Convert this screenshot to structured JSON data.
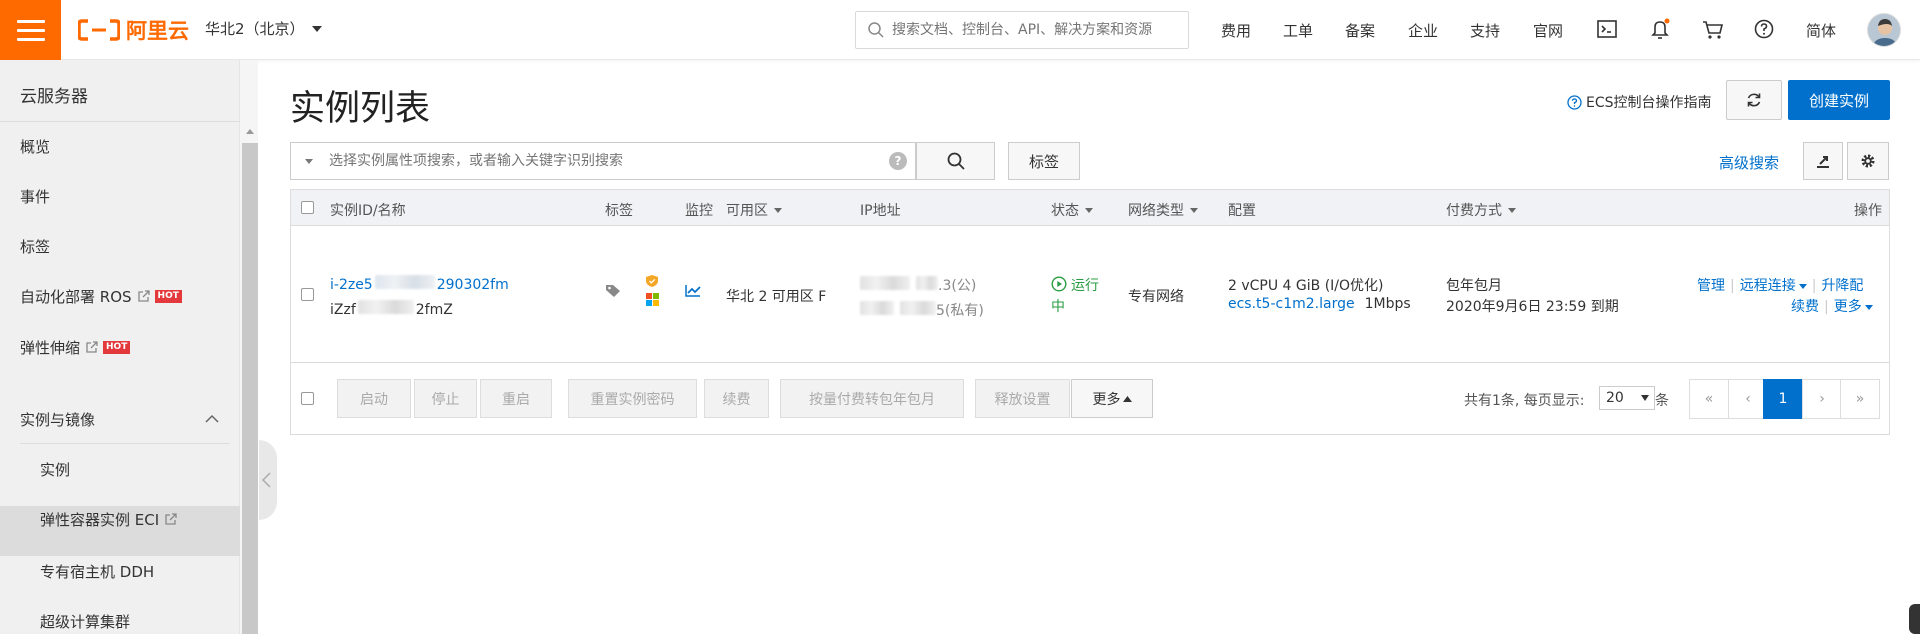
{
  "header": {
    "logo_text": "阿里云",
    "region": "华北2（北京）",
    "search_placeholder": "搜索文档、控制台、API、解决方案和资源",
    "nav": [
      "费用",
      "工单",
      "备案",
      "企业",
      "支持",
      "官网"
    ],
    "lang": "简体"
  },
  "sidebar": {
    "title": "云服务器",
    "items": [
      {
        "label": "概览"
      },
      {
        "label": "事件"
      },
      {
        "label": "标签"
      },
      {
        "label": "自动化部署 ROS",
        "hot": "HOT"
      },
      {
        "label": "弹性伸缩",
        "hot": "HOT"
      }
    ],
    "group": "实例与镜像",
    "sub_items": [
      {
        "label": "实例"
      },
      {
        "label": "弹性容器实例 ECI"
      },
      {
        "label": "专有宿主机 DDH"
      },
      {
        "label": "超级计算集群"
      }
    ]
  },
  "page": {
    "title": "实例列表",
    "guide": "ECS控制台操作指南",
    "create_button": "创建实例",
    "filter_placeholder": "选择实例属性项搜索，或者输入关键字识别搜索",
    "tag_button": "标签",
    "advanced_search": "高级搜索"
  },
  "table": {
    "headers": {
      "id": "实例ID/名称",
      "tags": "标签",
      "monitor": "监控",
      "zone": "可用区",
      "ip": "IP地址",
      "status": "状态",
      "network": "网络类型",
      "config": "配置",
      "billing": "付费方式",
      "actions": "操作"
    },
    "row": {
      "id_prefix": "i-2ze5",
      "id_suffix": "290302fm",
      "name_prefix": "iZzf",
      "name_suffix": "2fmZ",
      "zone": "华北 2 可用区 F",
      "ip_public_tail": ".3(公)",
      "ip_private_tail": "5(私有)",
      "status_line1": "运行",
      "status_line2": "中",
      "network": "专有网络",
      "config_line1": "2 vCPU 4 GiB (I/O优化)",
      "instance_type": "ecs.t5-c1m2.large",
      "bandwidth": "1Mbps",
      "billing_line1": "包年包月",
      "billing_line2": "2020年9月6日 23:59 到期",
      "actions": {
        "manage": "管理",
        "remote": "远程连接",
        "upgrade": "升降配",
        "renew": "续费",
        "more": "更多"
      }
    }
  },
  "footer": {
    "buttons": [
      "启动",
      "停止",
      "重启",
      "重置实例密码",
      "续费",
      "按量付费转包年包月",
      "释放设置"
    ],
    "more": "更多",
    "total_text": "共有1条, 每页显示:",
    "page_size": "20",
    "unit": "条",
    "pages": [
      "«",
      "‹",
      "1",
      "›",
      "»"
    ]
  },
  "colors": {
    "brand": "#ff6a00",
    "primary": "#0070cc",
    "running": "#2a9d42"
  }
}
